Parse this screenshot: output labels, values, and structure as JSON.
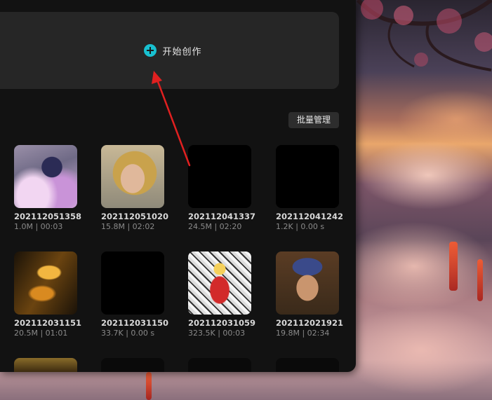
{
  "create": {
    "label": "开始创作",
    "icon": "plus-circle-icon",
    "accent": "#18c0d0"
  },
  "toolbar": {
    "batch_label": "批量管理"
  },
  "videos": [
    {
      "name": "202112051358",
      "meta": "1.0M | 00:03"
    },
    {
      "name": "202112051020",
      "meta": "15.8M | 02:02"
    },
    {
      "name": "202112041337",
      "meta": "24.5M | 02:20"
    },
    {
      "name": "202112041242",
      "meta": "1.2K | 0.00 s"
    },
    {
      "name": "202112031151",
      "meta": "20.5M | 01:01"
    },
    {
      "name": "202112031150",
      "meta": "33.7K | 0.00 s"
    },
    {
      "name": "202112031059",
      "meta": "323.5K | 00:03"
    },
    {
      "name": "202112021921",
      "meta": "19.8M | 02:34"
    }
  ],
  "annotation": {
    "color": "#e02020"
  }
}
